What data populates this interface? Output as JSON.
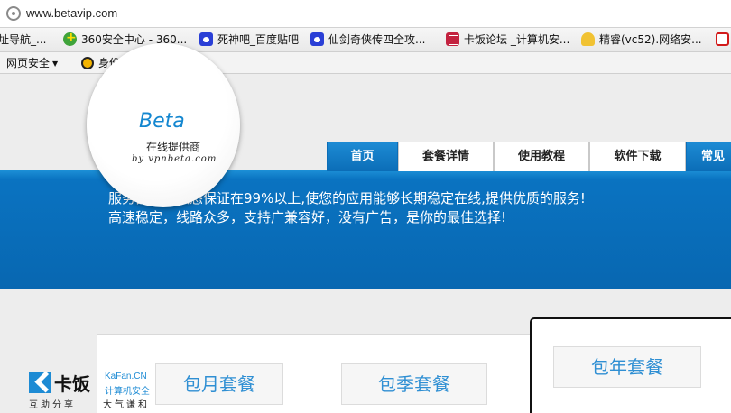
{
  "browser": {
    "url": "www.betavip.com",
    "bookmarks": [
      {
        "label": "址导航_...",
        "icon": "none"
      },
      {
        "label": "360安全中心 - 360...",
        "icon": "360-icon"
      },
      {
        "label": "死神吧_百度贴吧",
        "icon": "baidu-paw-icon"
      },
      {
        "label": "仙剑奇侠传四全攻...",
        "icon": "baidu-paw-icon"
      },
      {
        "label": "卡饭论坛 _计算机安...",
        "icon": "kafan-icon"
      },
      {
        "label": "精睿(vc52).网络安...",
        "icon": "jingrui-icon"
      },
      {
        "label": "",
        "icon": "bookmark-icon"
      }
    ],
    "toolbar": {
      "web_security": "网页安全",
      "identity_security": "身份安全"
    }
  },
  "site": {
    "logo": {
      "brand": "Beta",
      "subtitle": "在线提供商",
      "byline": "by vpnbeta.com"
    },
    "nav": {
      "tabs": [
        {
          "label": "首页",
          "active": true
        },
        {
          "label": "套餐详情",
          "active": false
        },
        {
          "label": "使用教程",
          "active": false
        },
        {
          "label": "软件下载",
          "active": false
        },
        {
          "label": "常见",
          "active": false
        }
      ]
    },
    "banner": {
      "line1": "服务器在线状态保证在99%以上,使您的应用能够长期稳定在线,提供优质的服务!",
      "line2": "高速稳定，线路众多，支持广兼容好，没有广告，是你的最佳选择!"
    },
    "packages": [
      {
        "label": "包月套餐"
      },
      {
        "label": "包季套餐"
      },
      {
        "label": "包年套餐"
      }
    ]
  },
  "watermark": {
    "name": "卡饭",
    "slogan1": "互助分享",
    "en": "KaFan.CN",
    "cn": "计算机安全",
    "slogan2": "大气谦和"
  },
  "colors": {
    "accent": "#0a72c0",
    "link_blue": "#2f8fd3"
  }
}
